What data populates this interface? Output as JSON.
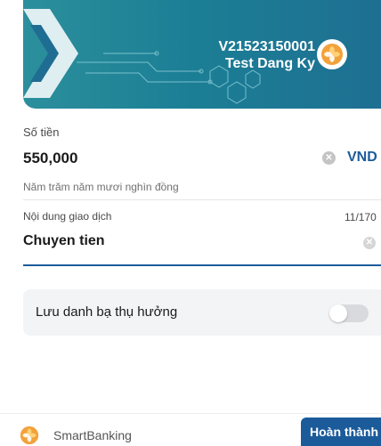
{
  "card": {
    "account_number": "V21523150001",
    "account_name": "Test Dang Ky"
  },
  "amount": {
    "label": "Số tiền",
    "value": "550,000",
    "currency": "VND",
    "in_words": "Năm trăm năm mươi nghìn đồng"
  },
  "content": {
    "label": "Nội dung giao dịch",
    "counter": "11/170",
    "value": "Chuyen tien"
  },
  "save_beneficiary": {
    "label": "Lưu danh bạ thụ hưởng",
    "enabled": false
  },
  "footer": {
    "brand": "SmartBanking",
    "done_label": "Hoàn thành"
  },
  "colors": {
    "primary": "#1c5b9a",
    "card_teal": "#2c8f9c",
    "logo_orange": "#f2a23a"
  }
}
